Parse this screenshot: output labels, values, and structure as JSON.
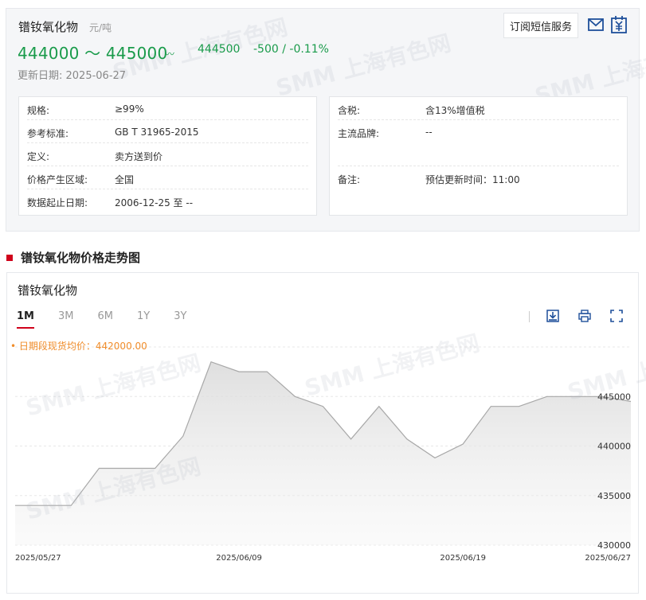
{
  "header": {
    "product_name": "镨钕氧化物",
    "unit": "元/吨",
    "price_range": "444000 ～ 445000",
    "average": "444500",
    "change": "-500  /  -0.11%",
    "update_label": "更新日期:  2025-06-27",
    "subscribe_label": "订阅短信服务",
    "watermark": "SMM 上海有色网"
  },
  "specs_left": [
    {
      "key": "规格:",
      "value": "≥99%"
    },
    {
      "key": "参考标准:",
      "value": "GB T 31965-2015"
    },
    {
      "key": "定义:",
      "value": "卖方送到价"
    },
    {
      "key": "价格产生区域:",
      "value": "全国"
    },
    {
      "key": "数据起止日期:",
      "value": "2006-12-25 至 --"
    }
  ],
  "specs_right": [
    {
      "key": "含税:",
      "value": "含13%增值税"
    },
    {
      "key": "主流品牌:",
      "value": "--"
    },
    {
      "key": "备注:",
      "value": "预估更新时间：11:00"
    }
  ],
  "section_title": "镨钕氧化物价格走势图",
  "chart_panel": {
    "title": "镨钕氧化物",
    "tabs": [
      "1M",
      "3M",
      "6M",
      "1Y",
      "3Y"
    ],
    "active_tab": "1M",
    "avg_note": "• 日期段现货均价：442000.00"
  },
  "colors": {
    "green": "#1a9b4b",
    "red_accent": "#d0021b",
    "orange_note": "#f08d2b",
    "line": "#a8a8a8"
  },
  "chart_data": {
    "type": "area",
    "x": [
      "2025/05/27",
      "2025/05/28",
      "2025/05/29",
      "2025/05/30",
      "2025/06/03",
      "2025/06/04",
      "2025/06/05",
      "2025/06/06",
      "2025/06/09",
      "2025/06/10",
      "2025/06/11",
      "2025/06/12",
      "2025/06/13",
      "2025/06/16",
      "2025/06/17",
      "2025/06/18",
      "2025/06/19",
      "2025/06/20",
      "2025/06/23",
      "2025/06/24",
      "2025/06/25",
      "2025/06/26",
      "2025/06/27"
    ],
    "y": [
      434000,
      434000,
      434000,
      437750,
      437750,
      437750,
      441000,
      448500,
      447500,
      447500,
      445000,
      444000,
      440700,
      444000,
      440700,
      438800,
      440200,
      444000,
      444000,
      445000,
      445000,
      445000,
      444500
    ],
    "x_tick_labels": [
      "2025/05/27",
      "2025/06/09",
      "2025/06/19",
      "2025/06/27"
    ],
    "y_ticks": [
      430000,
      435000,
      440000,
      445000
    ],
    "ylim": [
      430000,
      450000
    ],
    "grid": "horizontal dashed"
  }
}
